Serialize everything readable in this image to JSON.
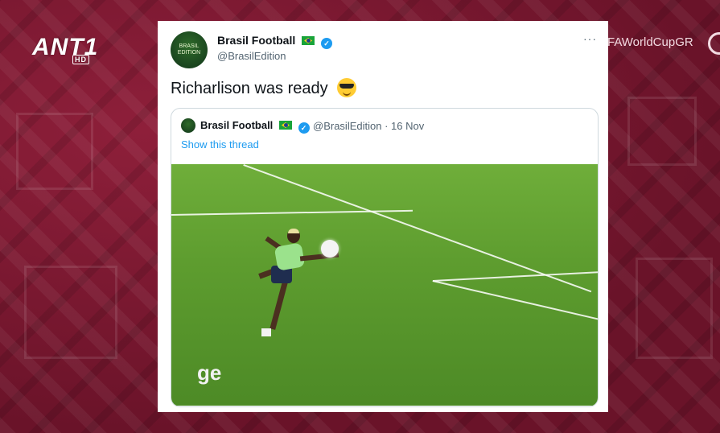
{
  "broadcast": {
    "channel_logo": "ANT1",
    "channel_badge": "HD",
    "hashtag": "FAWorldCupGR"
  },
  "tweet": {
    "author_name": "Brasil Football",
    "author_handle": "@BrasilEdition",
    "avatar_text": "BRASIL EDITION",
    "more_label": "···",
    "text": "Richarlison was ready",
    "verified_mark": "✓",
    "quote": {
      "author_name": "Brasil Football",
      "meta": "@BrasilEdition · 16 Nov",
      "show_thread": "Show this thread",
      "media_logo": "ge"
    }
  },
  "colors": {
    "background": "#7a1830",
    "link": "#1d9bf0",
    "verified": "#1d9bf0",
    "pitch": "#5e9d2f"
  },
  "icons": [
    "verified-badge-icon",
    "brazil-flag-icon",
    "more-options-icon",
    "sunglasses-emoji-icon"
  ]
}
